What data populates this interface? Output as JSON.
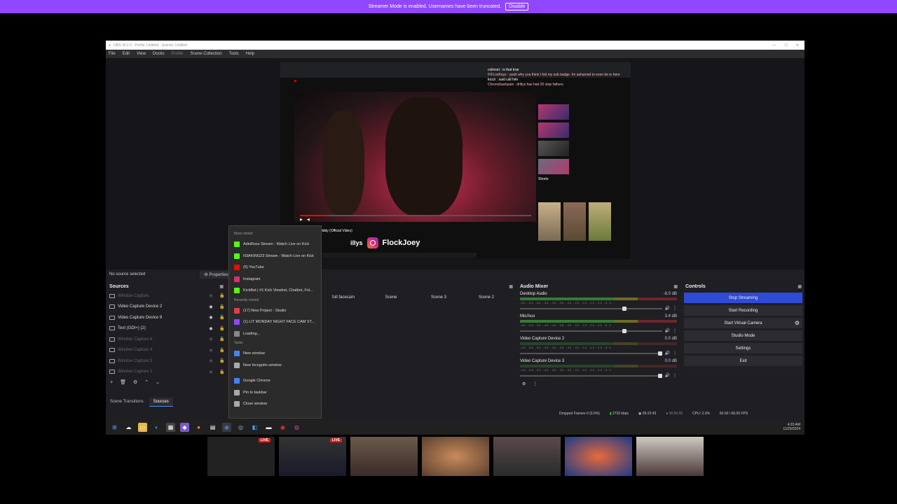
{
  "banner": {
    "message": "Streamer Mode is enabled. Usernames have been truncated.",
    "button": "Disable"
  },
  "obs": {
    "title": "OBS 30.2.2 - Profile: Untitled - Scenes: Untitled",
    "menu": [
      "File",
      "Edit",
      "View",
      "Docks",
      "Profile",
      "Scene Collection",
      "Tools",
      "Help"
    ],
    "no_source_selected": "No source selected",
    "properties": "Properties",
    "preview": {
      "chat": [
        "colinset : is that true",
        "FIFLosKeys : yeah why you think I hid my sub badge. Im ashamed to even be in here",
        "kozzi : said call him",
        "Chronicbackpain : drillys has had 20 step fathers"
      ],
      "watermark_prefix": "illys",
      "watermark_name": "FlockJoey",
      "video_title": "Diddy (Official Video)",
      "shorts_label": "Shorts"
    },
    "sources": {
      "title": "Sources",
      "items": [
        {
          "name": "Window Capture",
          "hidden": true
        },
        {
          "name": "Video Capture Device 2",
          "hidden": false
        },
        {
          "name": "Video Capture Device 9",
          "hidden": false
        },
        {
          "name": "Text (GDI+) (2)",
          "hidden": false
        },
        {
          "name": "Window Capture 6",
          "hidden": true
        },
        {
          "name": "Window Capture 4",
          "hidden": true
        },
        {
          "name": "Window Capture 5",
          "hidden": true
        },
        {
          "name": "Window Capture 2",
          "hidden": true
        }
      ]
    },
    "scenes": {
      "tabs": [
        "full facecam",
        "Scene",
        "Scene 3",
        "Scene 2"
      ]
    },
    "bottom_tabs": [
      "Scene Transitions",
      "Sources"
    ],
    "mixer": {
      "title": "Audio Mixer",
      "scale": "-60 -55 -50 -45 -40 -35 -30 -25 -20 -15 -10 -5 0",
      "channels": [
        {
          "name": "Desktop Audio",
          "db": "-8.0 dB",
          "level": 0.55
        },
        {
          "name": "Mic/Aux",
          "db": "3.4 dB",
          "level": 0.6
        },
        {
          "name": "Video Capture Device 2",
          "db": "0.0 dB",
          "level": 0.0
        },
        {
          "name": "Video Capture Device 3",
          "db": "0.0 dB",
          "level": 0.0
        }
      ]
    },
    "controls": {
      "title": "Controls",
      "buttons": [
        "Stop Streaming",
        "Start Recording",
        "Start Virtual Camera",
        "Studio Mode",
        "Settings",
        "Exit"
      ]
    },
    "stats": {
      "dropped": "Dropped Frames 0 (0.0%)",
      "bitrate": "2716 kbps",
      "live_time": "05:22:43",
      "rec_time": "00:00:00",
      "cpu": "CPU: 2.3%",
      "fps": "60.00 / 60.00 FPS"
    }
  },
  "jumplist": {
    "sections": {
      "most_visited": "Most visited",
      "recently_closed": "Recently closed",
      "tasks": "Tasks"
    },
    "most_visited": [
      {
        "label": "AdinRoss Stream - Watch Live on Kick",
        "color": "#53fc18"
      },
      {
        "label": "N3AKING23 Stream - Watch Live on Kick",
        "color": "#53fc18"
      },
      {
        "label": "(5) YouTube",
        "color": "#ff0000"
      },
      {
        "label": "Instagram",
        "color": "#dd2a7b"
      },
      {
        "label": "KickBot | #1 Kick Viewbot, Chatbot, Fol...",
        "color": "#53fc18"
      }
    ],
    "recently_closed": [
      {
        "label": "(17) New Project - Studio",
        "color": "#e04040"
      },
      {
        "label": "(1) LIT MONDAY NIGHT FACE CAM ST...",
        "color": "#9147ff"
      },
      {
        "label": "Loading...",
        "color": "#888888"
      }
    ],
    "tasks": [
      {
        "label": "New window",
        "color": "#4285f4"
      },
      {
        "label": "New Incognito window",
        "color": "#aaaaaa"
      }
    ],
    "app": [
      {
        "label": "Google Chrome",
        "color": "#4285f4"
      },
      {
        "label": "Pin to taskbar",
        "color": "#aaaaaa"
      },
      {
        "label": "Close window",
        "color": "#aaaaaa"
      }
    ]
  },
  "taskbar": {
    "time": "4:20 AM",
    "date": "11/25/2024"
  },
  "strip_live": "LIVE"
}
